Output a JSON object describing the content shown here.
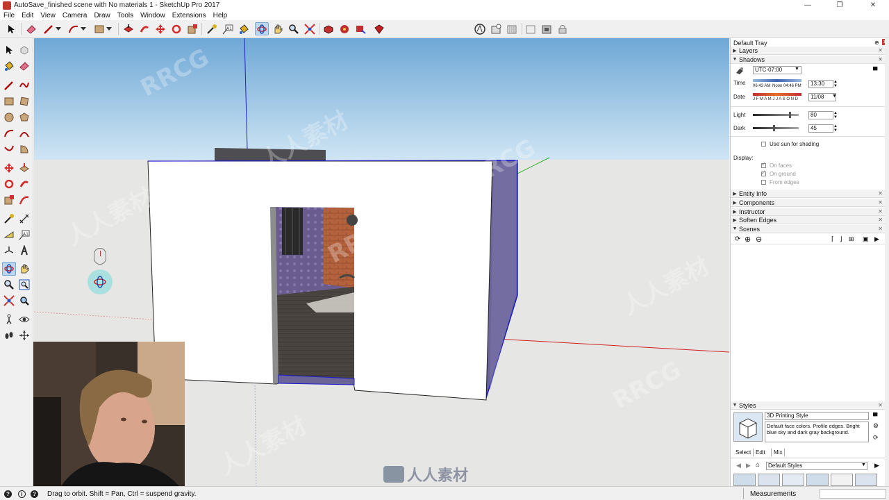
{
  "window": {
    "title": "AutoSave_finished scene with No materials 1 - SketchUp Pro 2017",
    "minimize": "—",
    "restore": "❐",
    "close": "✕"
  },
  "menu": [
    "File",
    "Edit",
    "View",
    "Camera",
    "Draw",
    "Tools",
    "Window",
    "Extensions",
    "Help"
  ],
  "watermark": {
    "primary": "RRCG",
    "secondary": "人人素材",
    "logo_text": "人人素材"
  },
  "tray": {
    "title": "Default Tray",
    "panels": {
      "layers": "Layers",
      "shadows": "Shadows",
      "entity_info": "Entity Info",
      "components": "Components",
      "instructor": "Instructor",
      "soften_edges": "Soften Edges",
      "scenes": "Scenes",
      "styles": "Styles"
    },
    "shadows": {
      "timezone": "UTC-07:00",
      "time_label": "Time",
      "time_sunrise": "06:43 AM",
      "time_noon": "Noon",
      "time_sunset": "04:46 PM",
      "time_value": "13:30",
      "date_label": "Date",
      "months": "J F M A M J J A S O N D",
      "date_value": "11/08",
      "light_label": "Light",
      "light_value": "80",
      "light_level": 0.8,
      "dark_label": "Dark",
      "dark_value": "45",
      "dark_level": 0.45,
      "use_sun": "Use sun for shading",
      "display_label": "Display:",
      "on_faces": "On faces",
      "on_ground": "On ground",
      "from_edges": "From edges"
    },
    "styles": {
      "style_name": "3D Printing Style",
      "description": "Default face colors. Profile edges. Bright blue sky and dark gray background.",
      "tabs": [
        "Select",
        "Edit",
        "Mix"
      ],
      "collection": "Default Styles"
    }
  },
  "status": {
    "hint": "Drag to orbit. Shift = Pan, Ctrl = suspend gravity.",
    "measurements_label": "Measurements",
    "info_icon": "i",
    "geo_icon": "?"
  },
  "colors": {
    "accent": "#7aa7d4",
    "sky": "#a8cde9",
    "ground": "#e6e6e4",
    "edge_selected": "#1a1ad0",
    "red_axis": "#d02020",
    "green_axis": "#30b030",
    "blue_axis": "#2020c0"
  }
}
